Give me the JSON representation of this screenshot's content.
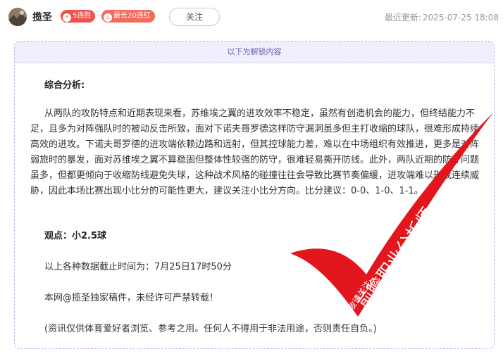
{
  "header": {
    "author_name": "揽圣",
    "badges": [
      {
        "icon": "lightning-icon",
        "label": "5连胜"
      },
      {
        "icon": "flame-icon",
        "label": "最长20连红"
      }
    ],
    "follow_label": "关注",
    "updated_prefix": "最近更新:",
    "updated_time": "2025-07-25 18:08"
  },
  "content": {
    "unlock_notice": "以下为解锁内容",
    "heading": "综合分析:",
    "analysis": "从两队的攻防特点和近期表现来看，苏维埃之翼的进攻效率不稳定，虽然有创造机会的能力，但终结能力不足，且多为对阵强队时的被动反击所致，面对下诺夫哥罗德这样防守漏洞虽多但主打收缩的球队，很难形成持续高效的进攻。下诺夫哥罗德的进攻端依赖边路和远射，但其控球能力差，难以在中场组织有效推进，更多是对阵弱旅时的暴发，面对苏维埃之翼不算稳固但整体性较强的防守，很难轻易撕开防线。此外，两队近期的防守问题虽多，但都更倾向于收缩防线避免失球，这种战术风格的碰撞往往会导致比赛节奏偏缓，进攻端难以形成连续威胁，因此本场比赛出现小比分的可能性更大，建议关注小比分方向。比分建议：0-0、1-0、1-1。",
    "viewpoint": "观点：小2.5球",
    "deadline": "以上各种数据截止时间为：7月25日17时50分",
    "copyright": "本网@揽圣独家稿件，未经许可严禁转载！",
    "disclaimer": "(资讯仅供体育爱好者浏览、参考之用。任何人不得用于非法用途，否则责任自负。)"
  },
  "watermark": {
    "line_main": "前瞻职业分析师",
    "line_small": "敬请关注",
    "color": "#e2161c"
  },
  "colors": {
    "badge": "#f2504b",
    "unlock_bar": "#efeefb",
    "unlock_text": "#6a62b5",
    "border": "#b9b2e3"
  }
}
